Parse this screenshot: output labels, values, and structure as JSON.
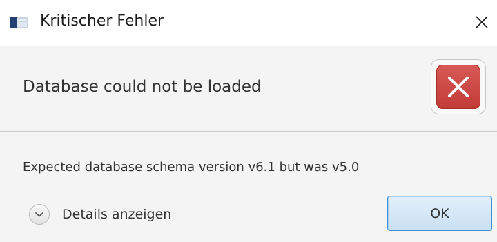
{
  "window": {
    "title": "Kritischer Fehler",
    "close_icon": "close-icon",
    "app_icon": "window-app-icon"
  },
  "header": {
    "text": "Database could not be loaded",
    "icon": "error-icon",
    "icon_color": "#c93f3b"
  },
  "content": {
    "message": "Expected database schema version v6.1 but was v5.0"
  },
  "footer": {
    "details_label": "Details anzeigen",
    "details_icon": "chevron-down-icon",
    "ok_label": "OK",
    "ok_border_color": "#3f8fd6"
  }
}
